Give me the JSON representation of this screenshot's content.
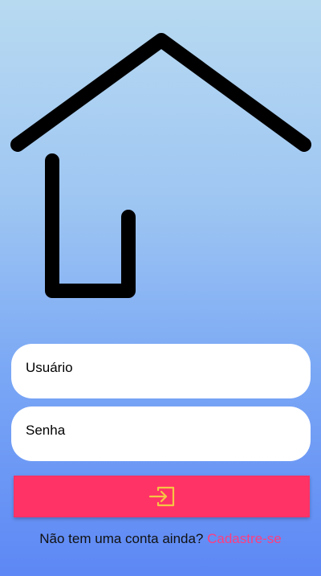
{
  "logo": {
    "icon": "house-icon",
    "color": "#000000"
  },
  "form": {
    "username": {
      "placeholder": "Usuário",
      "value": ""
    },
    "password": {
      "placeholder": "Senha",
      "value": ""
    },
    "login_button": {
      "icon": "login-enter-icon",
      "color": "#ff3366",
      "icon_color": "#f6c544"
    }
  },
  "signup": {
    "prompt": "Não tem uma conta ainda?",
    "link_text": "Cadastre-se",
    "link_color": "#ff3d7f"
  }
}
